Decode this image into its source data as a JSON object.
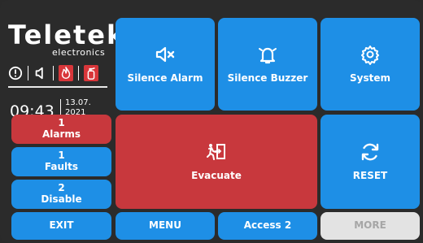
{
  "brand": {
    "name": "Teletek",
    "sub": "electronics"
  },
  "status_icons": [
    "alert-circle-icon",
    "speaker-icon",
    "fire-icon",
    "extinguisher-icon"
  ],
  "clock": {
    "time": "09:43",
    "date": "13.07.",
    "year": "2021"
  },
  "buttons": {
    "silence_alarm": "Silence Alarm",
    "silence_buzzer": "Silence Buzzer",
    "system": "System",
    "evacuate": "Evacuate",
    "reset": "RESET",
    "alarms": {
      "count": "1",
      "label": "Alarms"
    },
    "faults": {
      "count": "1",
      "label": "Faults"
    },
    "disable": {
      "count": "2",
      "label": "Disable"
    },
    "exit": "EXIT",
    "menu": "MENU",
    "access": "Access 2",
    "more": "MORE"
  },
  "colors": {
    "blue": "#1e8fe6",
    "red": "#c8383d",
    "disabled": "#e3e3e3",
    "background": "#2b2b2b"
  }
}
